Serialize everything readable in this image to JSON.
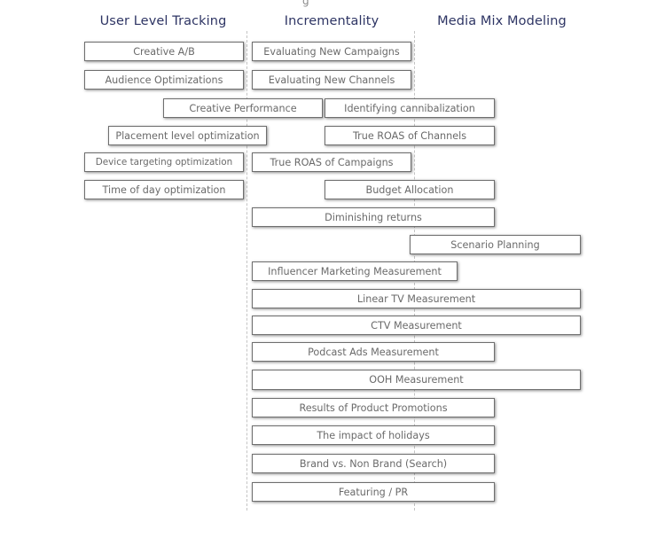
{
  "top_stub": "g",
  "columns": [
    {
      "title": "User Level Tracking"
    },
    {
      "title": "Incrementality"
    },
    {
      "title": "Media Mix Modeling"
    }
  ],
  "items": [
    {
      "label": "Creative A/B",
      "spans": [
        "User Level Tracking"
      ]
    },
    {
      "label": "Evaluating New Campaigns",
      "spans": [
        "Incrementality"
      ]
    },
    {
      "label": "Audience Optimizations",
      "spans": [
        "User Level Tracking"
      ]
    },
    {
      "label": "Evaluating New Channels",
      "spans": [
        "Incrementality"
      ]
    },
    {
      "label": "Creative Performance",
      "spans": [
        "User Level Tracking",
        "Incrementality"
      ]
    },
    {
      "label": "Identifying cannibalization",
      "spans": [
        "Incrementality",
        "Media Mix Modeling"
      ]
    },
    {
      "label": "Placement level optimization",
      "spans": [
        "User Level Tracking",
        "Incrementality"
      ]
    },
    {
      "label": "True ROAS of Channels",
      "spans": [
        "Incrementality",
        "Media Mix Modeling"
      ]
    },
    {
      "label": "Device targeting optimization",
      "spans": [
        "User Level Tracking"
      ]
    },
    {
      "label": "True ROAS of Campaigns",
      "spans": [
        "Incrementality"
      ]
    },
    {
      "label": "Time of day optimization",
      "spans": [
        "User Level Tracking"
      ]
    },
    {
      "label": "Budget Allocation",
      "spans": [
        "Incrementality",
        "Media Mix Modeling"
      ]
    },
    {
      "label": "Diminishing returns",
      "spans": [
        "Incrementality",
        "Media Mix Modeling"
      ]
    },
    {
      "label": "Scenario Planning",
      "spans": [
        "Media Mix Modeling"
      ]
    },
    {
      "label": "Influencer Marketing Measurement",
      "spans": [
        "Incrementality",
        "Media Mix Modeling"
      ]
    },
    {
      "label": "Linear TV Measurement",
      "spans": [
        "Incrementality",
        "Media Mix Modeling"
      ]
    },
    {
      "label": "CTV Measurement",
      "spans": [
        "Incrementality",
        "Media Mix Modeling"
      ]
    },
    {
      "label": "Podcast Ads Measurement",
      "spans": [
        "Incrementality",
        "Media Mix Modeling"
      ]
    },
    {
      "label": "OOH Measurement",
      "spans": [
        "Incrementality",
        "Media Mix Modeling"
      ]
    },
    {
      "label": "Results of Product Promotions",
      "spans": [
        "Incrementality",
        "Media Mix Modeling"
      ]
    },
    {
      "label": "The impact of holidays",
      "spans": [
        "Incrementality",
        "Media Mix Modeling"
      ]
    },
    {
      "label": "Brand vs. Non Brand (Search)",
      "spans": [
        "Incrementality",
        "Media Mix Modeling"
      ]
    },
    {
      "label": "Featuring / PR",
      "spans": [
        "Incrementality",
        "Media Mix Modeling"
      ]
    }
  ],
  "colors": {
    "title": "#2e3564",
    "box_border": "#6e6e6e",
    "box_text": "#6a6a6a",
    "divider": "#c4c4c4"
  }
}
